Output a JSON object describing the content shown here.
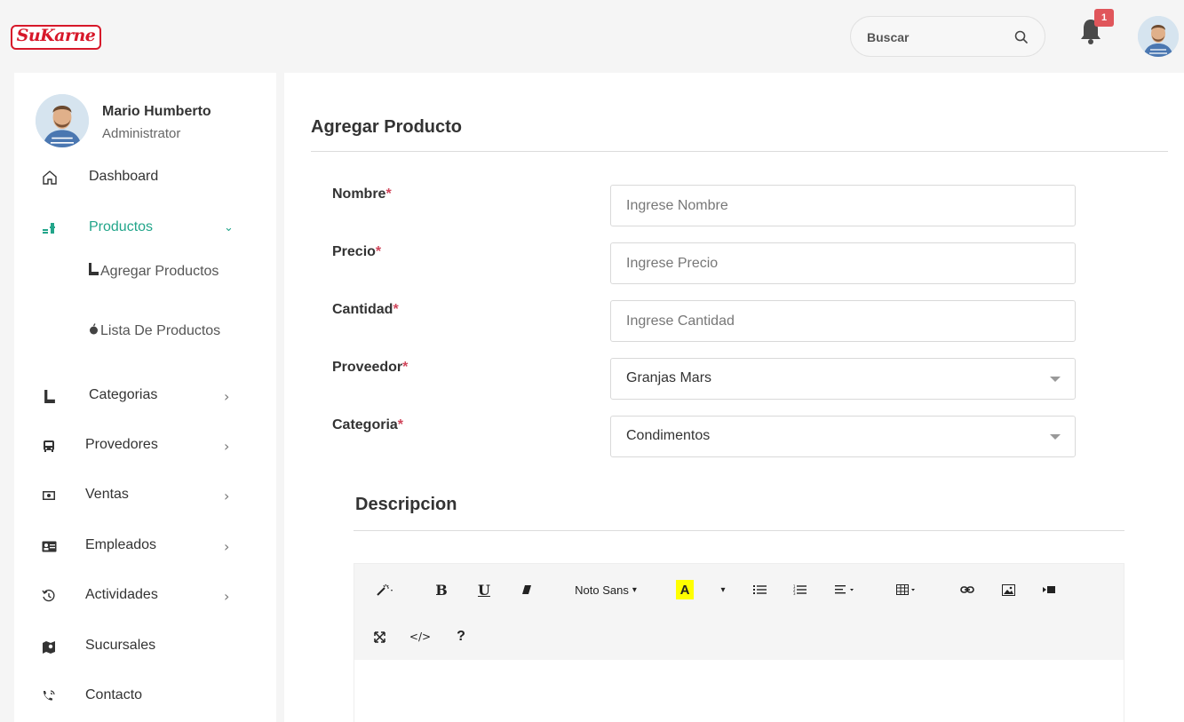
{
  "brand": {
    "logo_text": "SuKarne",
    "color": "#d7182a",
    "accent": "#22a58a"
  },
  "header": {
    "search_placeholder": "Buscar",
    "notification_count": "1"
  },
  "user": {
    "name": "Mario Humberto",
    "role": "Administrator"
  },
  "sidebar": {
    "items": [
      {
        "label": "Dashboard",
        "icon": "home-icon"
      },
      {
        "label": "Productos",
        "icon": "products-icon",
        "active": true,
        "expanded": true
      },
      {
        "label": "Categorias",
        "icon": "boot-icon"
      },
      {
        "label": "Provedores",
        "icon": "bus-icon"
      },
      {
        "label": "Ventas",
        "icon": "money-icon"
      },
      {
        "label": "Empleados",
        "icon": "id-card-icon"
      },
      {
        "label": "Actividades",
        "icon": "history-icon"
      },
      {
        "label": "Sucursales",
        "icon": "map-icon"
      },
      {
        "label": "Contacto",
        "icon": "phone-icon"
      }
    ],
    "subitems": [
      {
        "label": "Agregar Productos",
        "icon": "boot-icon"
      },
      {
        "label": "Lista De Productos",
        "icon": "apple-icon"
      }
    ],
    "chevron_right": "›",
    "chevron_down": "⌄"
  },
  "form": {
    "title": "Agregar Producto",
    "required_mark": "*",
    "fields": [
      {
        "label": "Nombre",
        "placeholder": "Ingrese Nombre"
      },
      {
        "label": "Precio",
        "placeholder": "Ingrese Precio"
      },
      {
        "label": "Cantidad",
        "placeholder": "Ingrese Cantidad"
      }
    ],
    "selects": [
      {
        "label": "Proveedor",
        "value": "Granjas Mars"
      },
      {
        "label": "Categoria",
        "value": "Condimentos"
      }
    ]
  },
  "description": {
    "title": "Descripcion",
    "toolbar": {
      "bold": "B",
      "underline": "U",
      "font": "Noto Sans",
      "font_color": "A",
      "code": "</>",
      "help": "?",
      "dropdown_caret": "▾"
    }
  }
}
